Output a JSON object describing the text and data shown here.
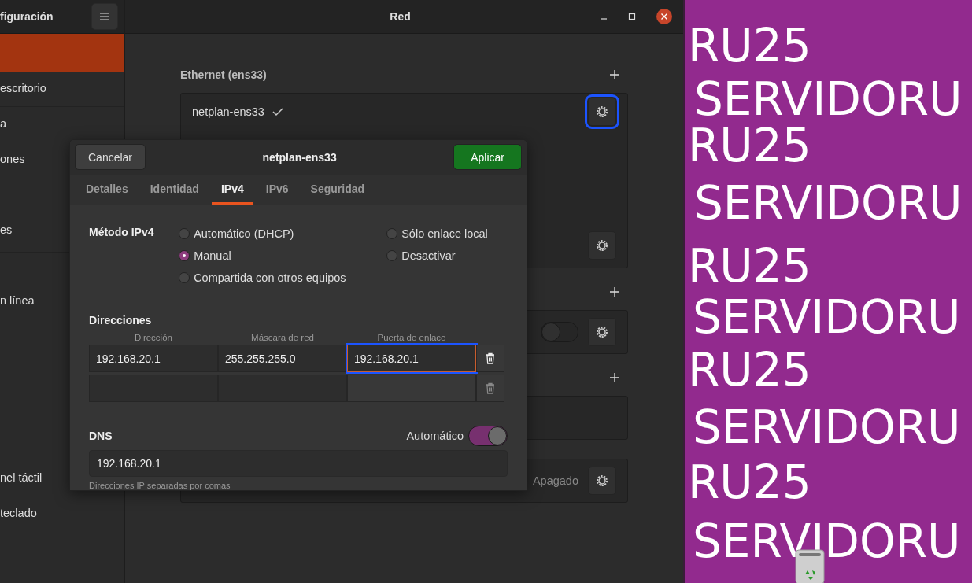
{
  "sidebar": {
    "title": "figuración",
    "items": [
      {
        "selected": true
      },
      {
        "label": "escritorio",
        "selected": false
      },
      {
        "label": "a",
        "selected": false
      },
      {
        "label": "ones",
        "selected": false
      },
      {
        "label": "es",
        "selected": false
      },
      {
        "label": "n línea",
        "selected": false
      },
      {
        "label": "nel táctil",
        "selected": false
      },
      {
        "label": "teclado",
        "selected": false
      }
    ]
  },
  "window": {
    "title": "Red"
  },
  "sections": [
    {
      "kind": "ethernet",
      "title": "Ethernet (ens33)",
      "connection": "netplan-ens33",
      "connected": true,
      "gear_focused": true
    },
    {
      "kind": "toggle",
      "on": false
    },
    {
      "kind": "empty"
    },
    {
      "kind": "status",
      "status": "Apagado"
    }
  ],
  "dialog": {
    "title": "netplan-ens33",
    "cancel": "Cancelar",
    "apply": "Aplicar",
    "tabs": [
      {
        "label": "Detalles",
        "selected": false
      },
      {
        "label": "Identidad",
        "selected": false
      },
      {
        "label": "IPv4",
        "selected": true
      },
      {
        "label": "IPv6",
        "selected": false
      },
      {
        "label": "Seguridad",
        "selected": false
      }
    ],
    "method": {
      "label": "Método IPv4",
      "options": [
        {
          "label": "Automático (DHCP)",
          "selected": false
        },
        {
          "label": "Manual",
          "selected": true
        },
        {
          "label": "Compartida con otros equipos",
          "selected": false
        },
        {
          "label": "Sólo enlace local",
          "selected": false
        },
        {
          "label": "Desactivar",
          "selected": false
        }
      ]
    },
    "addresses": {
      "title": "Direcciones",
      "columns": [
        "Dirección",
        "Máscara de red",
        "Puerta de enlace"
      ],
      "cells": [
        {
          "value": "192.168.20.1",
          "focused": false
        },
        {
          "value": "255.255.255.0",
          "focused": false
        },
        {
          "value": "192.168.20.1",
          "focused": true
        }
      ]
    },
    "dns": {
      "title": "DNS",
      "auto_label": "Automático",
      "auto_on": true,
      "value": "192.168.20.1",
      "hint": "Direcciones IP separadas por comas"
    }
  },
  "wallpaper": {
    "lines": [
      "RU25",
      "SERVIDORU",
      "RU25",
      "SERVIDORU",
      "RU25",
      "SERVIDORU",
      "RU25",
      "SERVIDORU",
      "RU25",
      "SERVIDORU"
    ]
  }
}
